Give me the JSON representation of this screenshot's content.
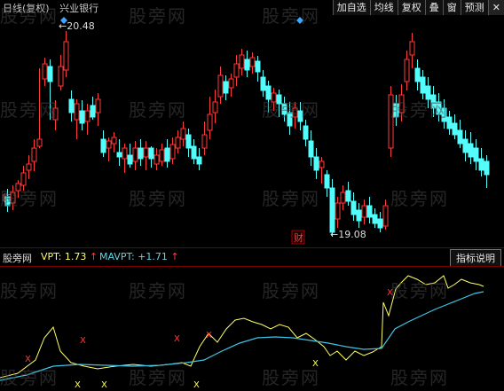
{
  "toolbar": {
    "period": "日线(复权)",
    "stock_name": "兴业银行",
    "buttons": [
      "加自选",
      "均线",
      "复权",
      "叠",
      "窗",
      "预测"
    ],
    "close": "✕"
  },
  "price_chart": {
    "high_label": "20.48",
    "low_label": "19.08",
    "event_badge": "财",
    "left_edge_label": "临",
    "colors": {
      "up": "#ff3c3c",
      "down": "#54fcfc",
      "marker": "#3fa7ff"
    }
  },
  "indicator": {
    "name": "股旁网",
    "vpt_label": "VPT: 1.73",
    "mavpt_label": "MAVPT: +1.71",
    "help_button": "指标说明",
    "colors": {
      "vpt": "#ffff66",
      "mavpt": "#3fc4e6",
      "sell": "#ff3c3c",
      "buy": "#ffff66"
    },
    "signal_sell": "X",
    "signal_buy": "X"
  },
  "watermark": "股旁网"
}
